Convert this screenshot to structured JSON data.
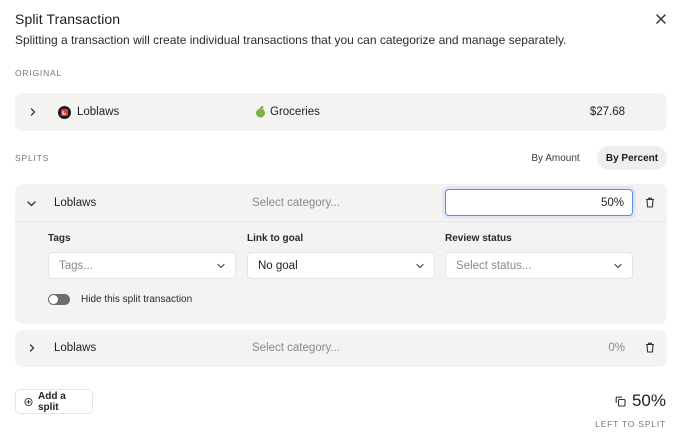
{
  "dialog": {
    "title": "Split Transaction",
    "description": "Splitting a transaction will create individual transactions that you can categorize and manage separately."
  },
  "original": {
    "section_label": "ORIGINAL",
    "merchant": "Loblaws",
    "category": "Groceries",
    "amount": "$27.68"
  },
  "splits": {
    "section_label": "SPLITS",
    "mode_options": [
      "By Amount",
      "By Percent"
    ],
    "selected_mode": "By Percent",
    "items": [
      {
        "merchant": "Loblaws",
        "category_placeholder": "Select category...",
        "percent": "50%",
        "expanded": true,
        "tags_label": "Tags",
        "tags_placeholder": "Tags...",
        "goal_label": "Link to goal",
        "goal_value": "No goal",
        "review_label": "Review status",
        "review_placeholder": "Select status...",
        "hide_label": "Hide this split transaction"
      },
      {
        "merchant": "Loblaws",
        "category_placeholder": "Select category...",
        "percent": "0%",
        "expanded": false
      }
    ]
  },
  "footer": {
    "add_label": "Add a split",
    "left_value": "50%",
    "left_label": "LEFT TO SPLIT"
  },
  "colors": {
    "panel": "#f4f3f2",
    "focus_border": "#5b8ee6",
    "logo_red": "#e53935",
    "apple_green": "#7cb342"
  },
  "icons": {
    "close": "x-icon",
    "expand": "chevron-right-icon",
    "collapse": "chevron-down-icon",
    "dropdown": "chevron-down-icon",
    "delete": "trash-icon",
    "add": "plus-circle-icon",
    "copy": "copy-icon",
    "category": "green-apple-icon",
    "merchant_logo": "loblaws-logo"
  }
}
